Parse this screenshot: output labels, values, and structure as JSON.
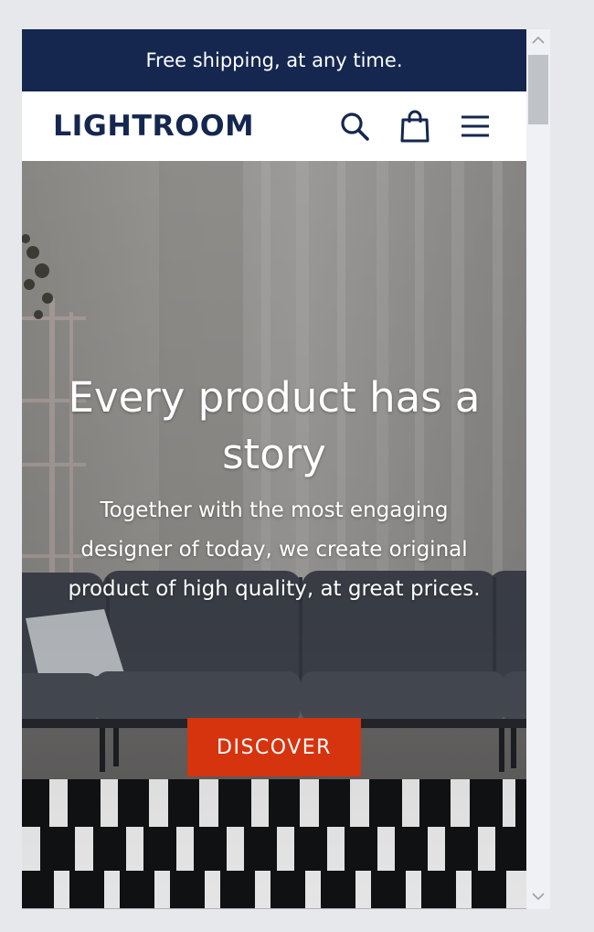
{
  "announcement": {
    "text": "Free shipping, at any time."
  },
  "header": {
    "logo": "LIGHTROOM",
    "icons": [
      "search-icon",
      "shopping-bag-icon",
      "menu-icon"
    ]
  },
  "hero": {
    "title": "Every product has a story",
    "subtitle": "Together with the most engaging designer of today, we create original product of high quality, at great prices.",
    "cta_label": "DISCOVER"
  },
  "colors": {
    "brand_navy": "#15274f",
    "cta_red": "#d6330f",
    "page_bg": "#e6e8eb"
  }
}
